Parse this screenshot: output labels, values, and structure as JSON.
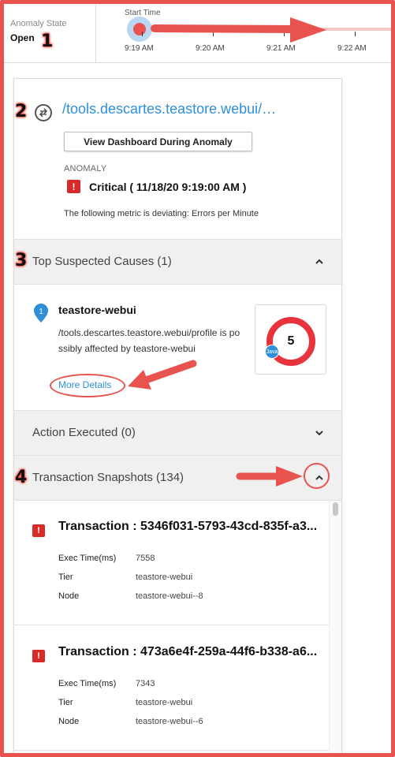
{
  "top": {
    "anomaly_state_label": "Anomaly State",
    "anomaly_state_value": "Open",
    "start_time_label": "Start Time",
    "ticks": [
      "9:19 AM",
      "9:20 AM",
      "9:21 AM",
      "9:22 AM"
    ]
  },
  "callouts": [
    "1",
    "2",
    "3",
    "4"
  ],
  "anomaly": {
    "page_link": "/tools.descartes.teastore.webui/…",
    "dashboard_button": "View Dashboard During Anomaly",
    "section_label": "ANOMALY",
    "severity_icon": "!",
    "severity_text": "Critical ( 11/18/20 9:19:00 AM )",
    "metric_text": "The following metric is deviating: Errors per Minute"
  },
  "causes": {
    "title": "Top Suspected Causes (1)",
    "item": {
      "pin_number": "1",
      "name": "teastore-webui",
      "description": "/tools.descartes.teastore.webui/profile is possibly affected by teastore-webui",
      "more_details": "More Details",
      "count": "5",
      "badge": "Java"
    }
  },
  "actions": {
    "title": "Action Executed (0)"
  },
  "snapshots": {
    "title": "Transaction Snapshots (134)",
    "items": [
      {
        "icon": "!",
        "title": "Transaction : 5346f031-5793-43cd-835f-a3...",
        "rows": [
          {
            "label": "Exec Time(ms)",
            "value": "7558"
          },
          {
            "label": "Tier",
            "value": "teastore-webui"
          },
          {
            "label": "Node",
            "value": "teastore-webui--8"
          }
        ]
      },
      {
        "icon": "!",
        "title": "Transaction : 473a6e4f-259a-44f6-b338-a6...",
        "rows": [
          {
            "label": "Exec Time(ms)",
            "value": "7343"
          },
          {
            "label": "Tier",
            "value": "teastore-webui"
          },
          {
            "label": "Node",
            "value": "teastore-webui--6"
          }
        ]
      }
    ]
  },
  "colors": {
    "annotation_red": "#e8534f",
    "critical_red": "#d92a2a",
    "link_blue": "#2f8fd8"
  }
}
